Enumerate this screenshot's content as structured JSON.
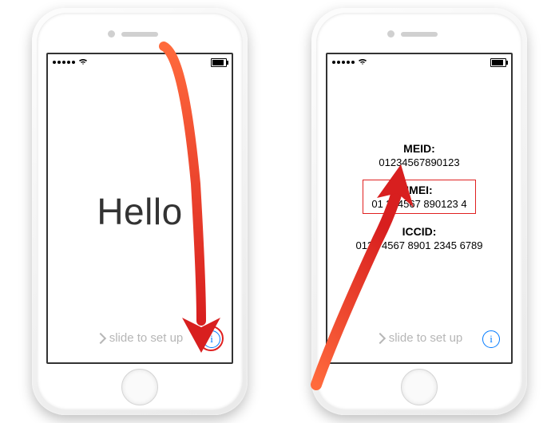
{
  "status_bar": {
    "wifi_icon": "wifi",
    "battery_icon": "battery"
  },
  "setup": {
    "hello_text": "Hello",
    "slide_text": "slide to set up",
    "info_symbol": "i"
  },
  "device_info": {
    "meid": {
      "label": "MEID:",
      "value": "01234567890123"
    },
    "imei": {
      "label": "IMEI:",
      "value": "01 234567 890123 4"
    },
    "iccid": {
      "label": "ICCID:",
      "value": "0123 4567 8901 2345 6789"
    }
  }
}
